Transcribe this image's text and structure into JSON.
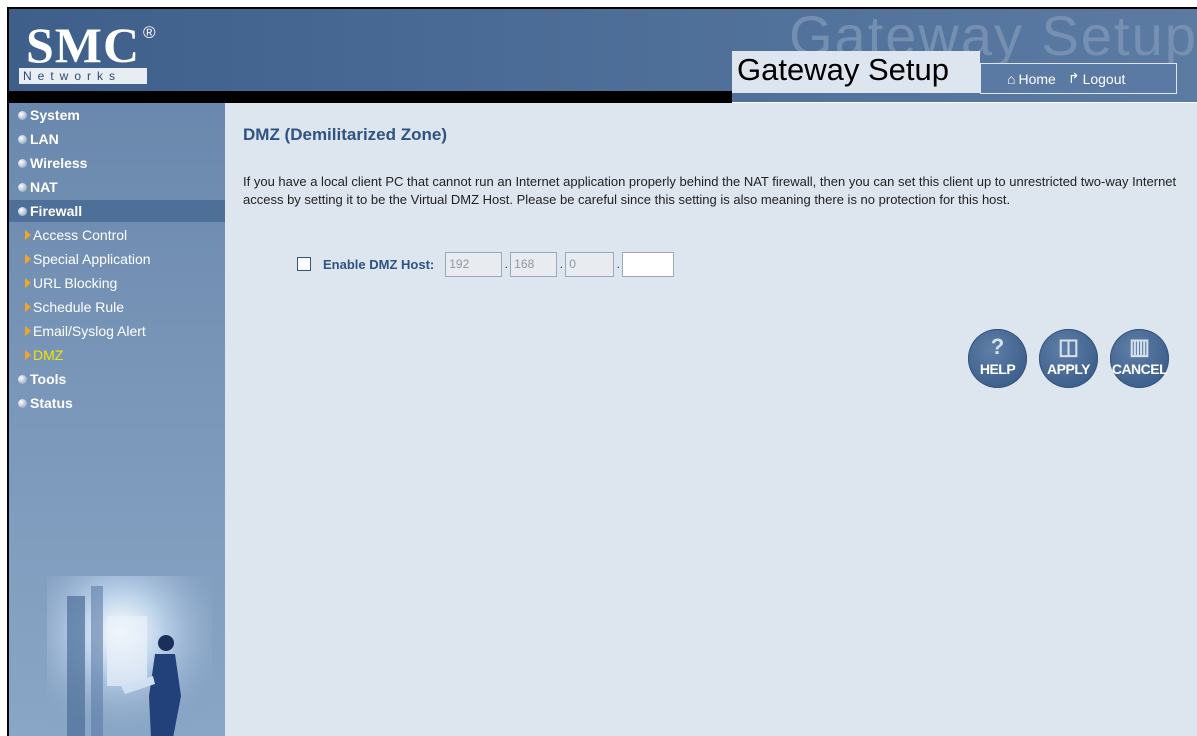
{
  "header": {
    "logo": "SMC",
    "logo_reg": "®",
    "logo_sub": "Networks",
    "watermark": "Gateway Setup",
    "title": "Gateway Setup",
    "home_label": "Home",
    "logout_label": "Logout"
  },
  "sidebar": {
    "items": [
      {
        "label": "System"
      },
      {
        "label": "LAN"
      },
      {
        "label": "Wireless"
      },
      {
        "label": "NAT"
      },
      {
        "label": "Firewall"
      },
      {
        "label": "Tools"
      },
      {
        "label": "Status"
      }
    ],
    "firewall_sub": [
      {
        "label": "Access Control"
      },
      {
        "label": "Special Application"
      },
      {
        "label": "URL Blocking"
      },
      {
        "label": "Schedule Rule"
      },
      {
        "label": "Email/Syslog Alert"
      },
      {
        "label": "DMZ"
      }
    ]
  },
  "main": {
    "title": "DMZ (Demilitarized Zone)",
    "description": "If you have a local client PC that cannot run an Internet application properly behind the NAT firewall, then you can set this client up to unrestricted two-way Internet access by setting it to be the Virtual DMZ Host. Please be careful since this setting is also meaning there is no protection for this host.",
    "dmz_label": "Enable DMZ Host:",
    "ip": {
      "o1": "192",
      "o2": "168",
      "o3": "0",
      "o4": ""
    },
    "buttons": {
      "help": "HELP",
      "apply": "APPLY",
      "cancel": "CANCEL"
    }
  }
}
